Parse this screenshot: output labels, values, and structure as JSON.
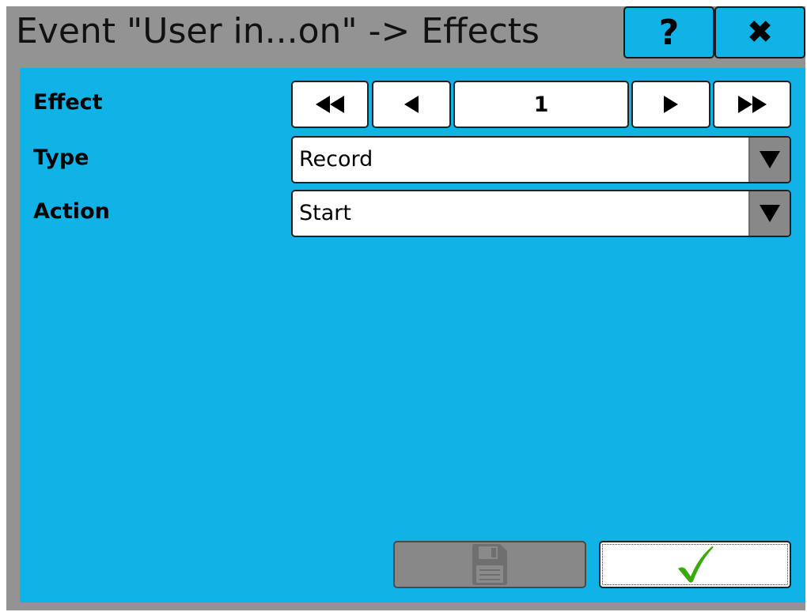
{
  "window": {
    "title": "Event \"User in...on\" -> Effects",
    "help_label": "?",
    "close_label": "✖"
  },
  "form": {
    "effect_label": "Effect",
    "effect_index": "1",
    "type_label": "Type",
    "type_value": "Record",
    "action_label": "Action",
    "action_value": "Start"
  },
  "icons": {
    "first": "double-left-arrow-icon",
    "prev": "left-arrow-icon",
    "next": "right-arrow-icon",
    "last": "double-right-arrow-icon",
    "dropdown": "dropdown-arrow-icon",
    "save": "floppy-disk-icon",
    "confirm": "checkmark-icon"
  },
  "colors": {
    "panel": "#11b3e6",
    "frame": "#939393",
    "disabled": "#888888",
    "check": "#39a90e"
  },
  "state": {
    "save_enabled": false
  }
}
